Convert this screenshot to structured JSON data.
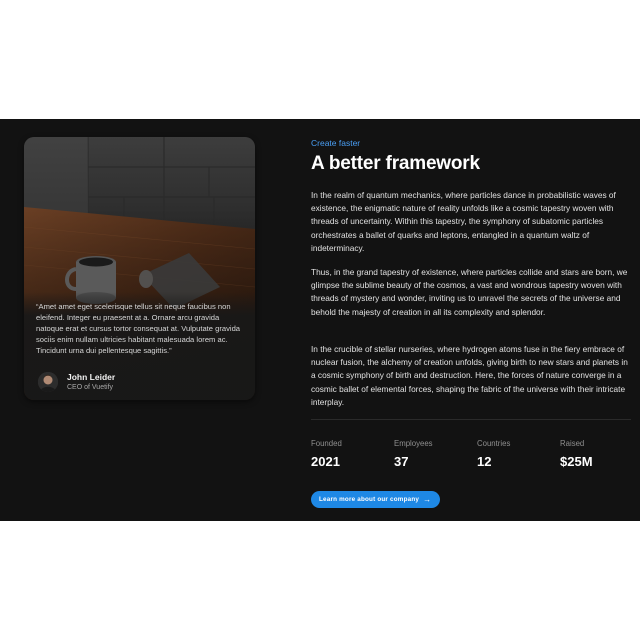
{
  "testimonial": {
    "quote": "“Amet amet eget scelerisque tellus sit neque faucibus non eleifend. Integer eu praesent at a. Ornare arcu gravida natoque erat et cursus tortor consequat at. Vulputate gravida sociis enim nullam ultricies habitant malesuada lorem ac. Tincidunt urna dui pellentesque sagittis.”",
    "author_name": "John Leider",
    "author_role": "CEO of Vuetify"
  },
  "content": {
    "eyebrow": "Create faster",
    "headline": "A better framework",
    "paragraphs": [
      "In the realm of quantum mechanics, where particles dance in probabilistic waves of existence, the enigmatic nature of reality unfolds like a cosmic tapestry woven with threads of uncertainty. Within this tapestry, the symphony of subatomic particles orchestrates a ballet of quarks and leptons, entangled in a quantum waltz of indeterminacy.",
      "Thus, in the grand tapestry of existence, where particles collide and stars are born, we glimpse the sublime beauty of the cosmos, a vast and wondrous tapestry woven with threads of mystery and wonder, inviting us to unravel the secrets of the universe and behold the majesty of creation in all its complexity and splendor.",
      "In the crucible of stellar nurseries, where hydrogen atoms fuse in the fiery embrace of nuclear fusion, the alchemy of creation unfolds, giving birth to new stars and planets in a cosmic symphony of birth and destruction. Here, the forces of nature converge in a cosmic ballet of elemental forces, shaping the fabric of the universe with their intricate interplay."
    ]
  },
  "stats": [
    {
      "label": "Founded",
      "value": "2021"
    },
    {
      "label": "Employees",
      "value": "37"
    },
    {
      "label": "Countries",
      "value": "12"
    },
    {
      "label": "Raised",
      "value": "$25M"
    }
  ],
  "cta": {
    "label": "Learn more about our company",
    "icon": "arrow-right-icon"
  },
  "colors": {
    "accent": "#1e88e5",
    "eyebrow": "#4a9ff5",
    "background": "#121212"
  }
}
